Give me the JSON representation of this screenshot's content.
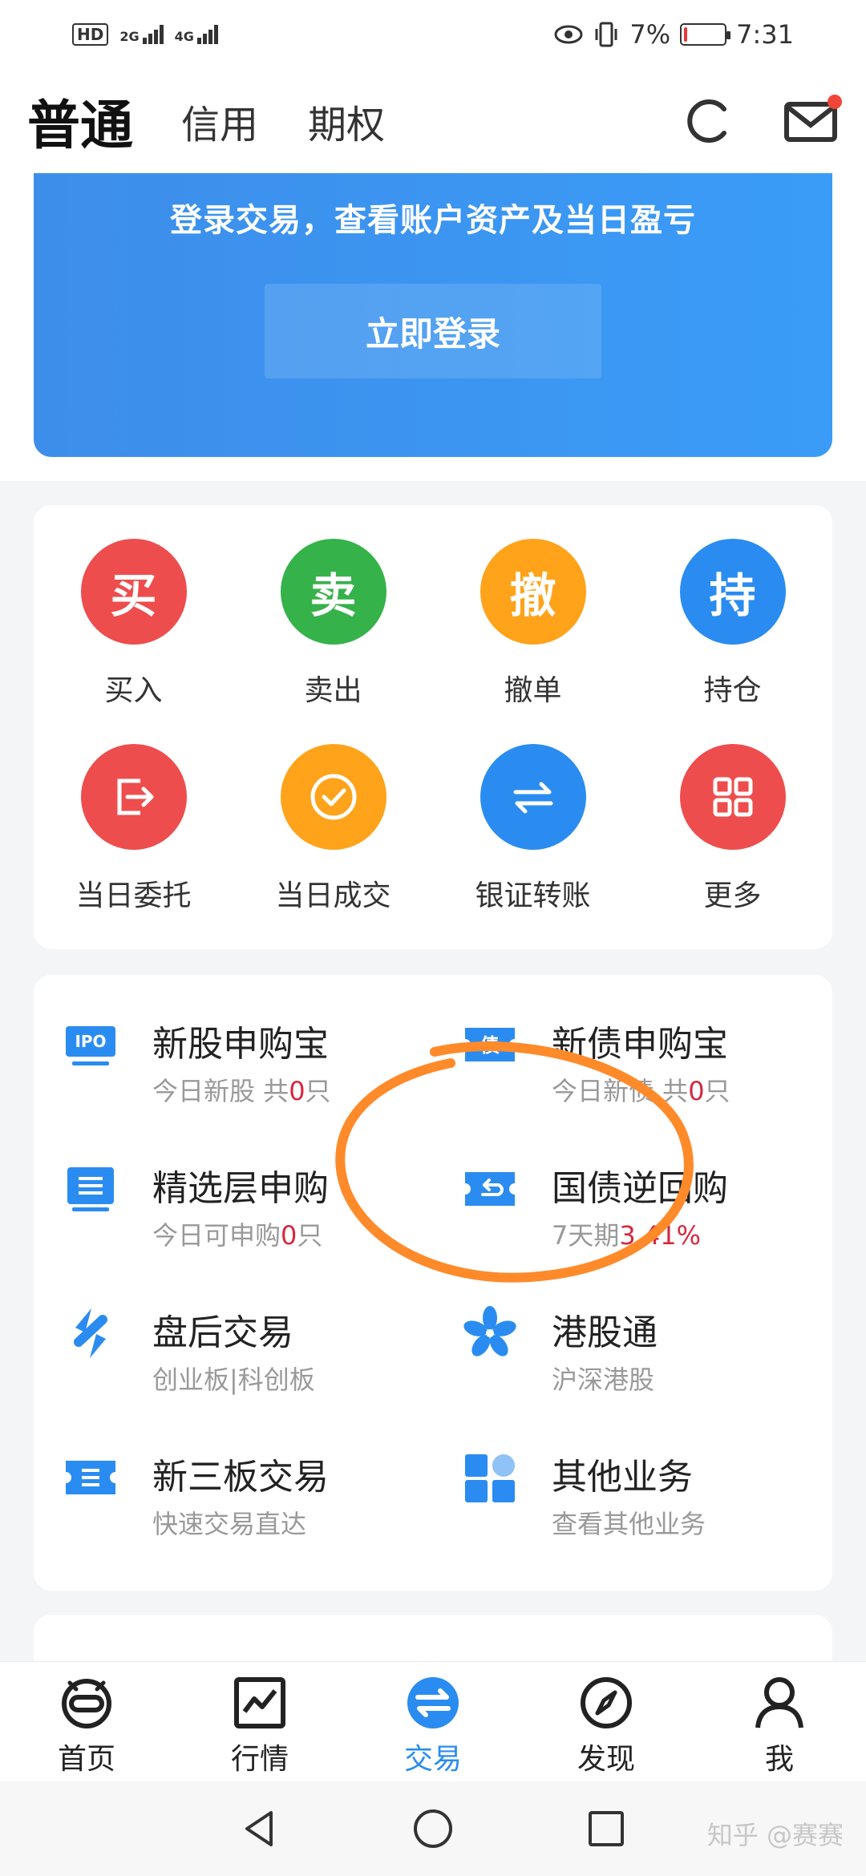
{
  "status_bar": {
    "hd": "HD",
    "sim1": "2G",
    "sim2": "4G",
    "battery_percent": "7%",
    "battery_level": 0.07,
    "time": "7:31"
  },
  "header": {
    "tabs": [
      "普通",
      "信用",
      "期权"
    ],
    "refresh_icon": "refresh-icon",
    "mail_icon": "mail-icon"
  },
  "banner": {
    "text": "登录交易，查看账户资产及当日盈亏",
    "login_label": "立即登录"
  },
  "quick_actions": [
    {
      "glyph": "买",
      "label": "买入",
      "color": "#ee4d4d"
    },
    {
      "glyph": "卖",
      "label": "卖出",
      "color": "#35b24a"
    },
    {
      "glyph": "撤",
      "label": "撤单",
      "color": "#ffa31a"
    },
    {
      "glyph": "持",
      "label": "持仓",
      "color": "#2a8cf0"
    },
    {
      "icon": "exit-box-icon",
      "label": "当日委托",
      "color": "#ee4d4d"
    },
    {
      "icon": "check-circle-icon",
      "label": "当日成交",
      "color": "#ffa31a"
    },
    {
      "icon": "transfer-arrows-icon",
      "label": "银证转账",
      "color": "#2a8cf0"
    },
    {
      "icon": "grid-icon",
      "label": "更多",
      "color": "#ee4d4d"
    }
  ],
  "services": [
    {
      "icon": "ipo-icon",
      "icon_text": "IPO",
      "title": "新股申购宝",
      "sub_pre": "今日新股 共",
      "sub_hl": "0",
      "sub_post": "只"
    },
    {
      "icon": "bond-ticket-icon",
      "icon_text": "债",
      "title": "新债申购宝",
      "sub_pre": "今日新债 共",
      "sub_hl": "0",
      "sub_post": "只"
    },
    {
      "icon": "list-doc-icon",
      "title": "精选层申购",
      "sub_pre": "今日可申购",
      "sub_hl": "0",
      "sub_post": "只"
    },
    {
      "icon": "repo-ticket-icon",
      "title": "国债逆回购",
      "sub_pre": "7天期",
      "sub_hl": "3.41%",
      "sub_post": ""
    },
    {
      "icon": "after-hours-icon",
      "title": "盘后交易",
      "sub_pre": "创业板|科创板",
      "sub_hl": "",
      "sub_post": ""
    },
    {
      "icon": "bauhinia-icon",
      "title": "港股通",
      "sub_pre": "沪深港股",
      "sub_hl": "",
      "sub_post": ""
    },
    {
      "icon": "neeq-ticket-icon",
      "title": "新三板交易",
      "sub_pre": "快速交易直达",
      "sub_hl": "",
      "sub_post": ""
    },
    {
      "icon": "other-grid-icon",
      "title": "其他业务",
      "sub_pre": "查看其他业务",
      "sub_hl": "",
      "sub_post": ""
    }
  ],
  "bottom_nav": [
    {
      "icon": "home-icon",
      "label": "首页"
    },
    {
      "icon": "market-chart-icon",
      "label": "行情"
    },
    {
      "icon": "trade-exchange-icon",
      "label": "交易",
      "active": true
    },
    {
      "icon": "compass-icon",
      "label": "发现"
    },
    {
      "icon": "person-icon",
      "label": "我"
    }
  ],
  "watermark": "知乎 @赛赛",
  "colors": {
    "accent": "#2a8cf0",
    "highlight": "#d6283f",
    "annotation": "#ff8a2a"
  }
}
